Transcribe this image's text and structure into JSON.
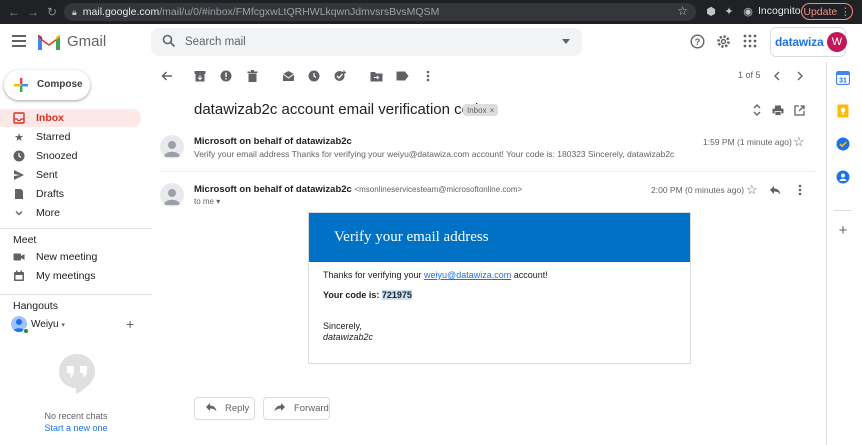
{
  "browser": {
    "url_host": "mail.google.com",
    "url_path": "/mail/u/0/#inbox/FMfcgxwLtQRHWLkqwnJdmvsrsBvsMQSM",
    "incognito_label": "Incognito",
    "update_label": "Update"
  },
  "header": {
    "app_name": "Gmail",
    "search_placeholder": "Search mail",
    "brand": "datawiza",
    "avatar_initial": "W"
  },
  "sidebar": {
    "compose_label": "Compose",
    "items": [
      {
        "label": "Inbox",
        "icon": "inbox-icon",
        "active": true
      },
      {
        "label": "Starred",
        "icon": "star-icon"
      },
      {
        "label": "Snoozed",
        "icon": "clock-icon"
      },
      {
        "label": "Sent",
        "icon": "send-icon"
      },
      {
        "label": "Drafts",
        "icon": "draft-icon"
      },
      {
        "label": "More",
        "icon": "chevron-down-icon"
      }
    ],
    "meet": {
      "title": "Meet",
      "items": [
        {
          "label": "New meeting",
          "icon": "video-icon"
        },
        {
          "label": "My meetings",
          "icon": "calendar-icon"
        }
      ]
    },
    "hangouts": {
      "title": "Hangouts",
      "user": "Weiyu",
      "no_chats": "No recent chats",
      "start_new": "Start a new one"
    }
  },
  "toolbar": {
    "page_count": "1 of 5"
  },
  "thread": {
    "subject": "datawizab2c account email verification code",
    "label_chip": "Inbox",
    "messages": [
      {
        "sender": "Microsoft on behalf of datawizab2c",
        "snippet": "Verify your email address Thanks for verifying your weiyu@datawiza.com account! Your code is: 180323 Sincerely, datawizab2c",
        "time": "1:59 PM (1 minute ago)"
      },
      {
        "sender": "Microsoft on behalf of datawizab2c",
        "sender_email": "<msonlineservicesteam@microsoftonline.com>",
        "time": "2:00 PM (0 minutes ago)",
        "to": "to me"
      }
    ],
    "email_body": {
      "title": "Verify your email address",
      "line1_prefix": "Thanks for verifying your ",
      "line1_link": "weiyu@datawiza.com",
      "line1_suffix": " account!",
      "code_label": "Your code is: ",
      "code_value": "721975",
      "sincerely": "Sincerely,",
      "signature": "datawizab2c"
    },
    "reply_label": "Reply",
    "forward_label": "Forward"
  },
  "colors": {
    "accent_red": "#d93025",
    "banner_blue": "#0072c6",
    "link_blue": "#1a73e8"
  }
}
